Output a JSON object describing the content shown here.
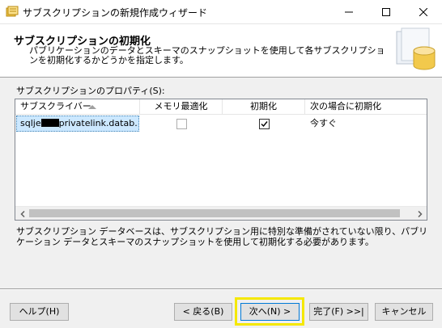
{
  "window": {
    "title": "サブスクリプションの新規作成ウィザード",
    "icon": "wizard-app-icon",
    "controls": [
      "minimize-icon",
      "maximize-icon",
      "close-icon"
    ]
  },
  "header": {
    "title": "サブスクリプションの初期化",
    "description": "パブリケーションのデータとスキーマのスナップショットを使用して各サブスクリプションを初期化するかどうかを指定します。",
    "art": "database-wizard-icon"
  },
  "properties": {
    "label": "サブスクリプションのプロパティ(S):",
    "columns": [
      "サブスクライバー",
      "メモリ最適化",
      "初期化",
      "次の場合に初期化"
    ],
    "sort_column": "サブスクライバー",
    "sort_direction": "ascending",
    "rows": [
      {
        "subscriber_prefix": "sqlje",
        "subscriber_suffix": "privatelink.datab...",
        "memory_optimized": false,
        "initialize": true,
        "initialize_when": "今すぐ"
      }
    ]
  },
  "info_text": "サブスクリプション データベースは、サブスクリプション用に特別な準備がされていない限り、パブリケーション データとスキーマのスナップショットを使用して初期化する必要があります。",
  "buttons": {
    "help": "ヘルプ(H)",
    "back": "< 戻る(B)",
    "next": "次へ(N) >",
    "finish": "完了(F) >>|",
    "cancel": "キャンセル"
  },
  "colors": {
    "highlight": "#f5e800",
    "selection": "#cce8ff",
    "focus_border": "#0078d7"
  }
}
